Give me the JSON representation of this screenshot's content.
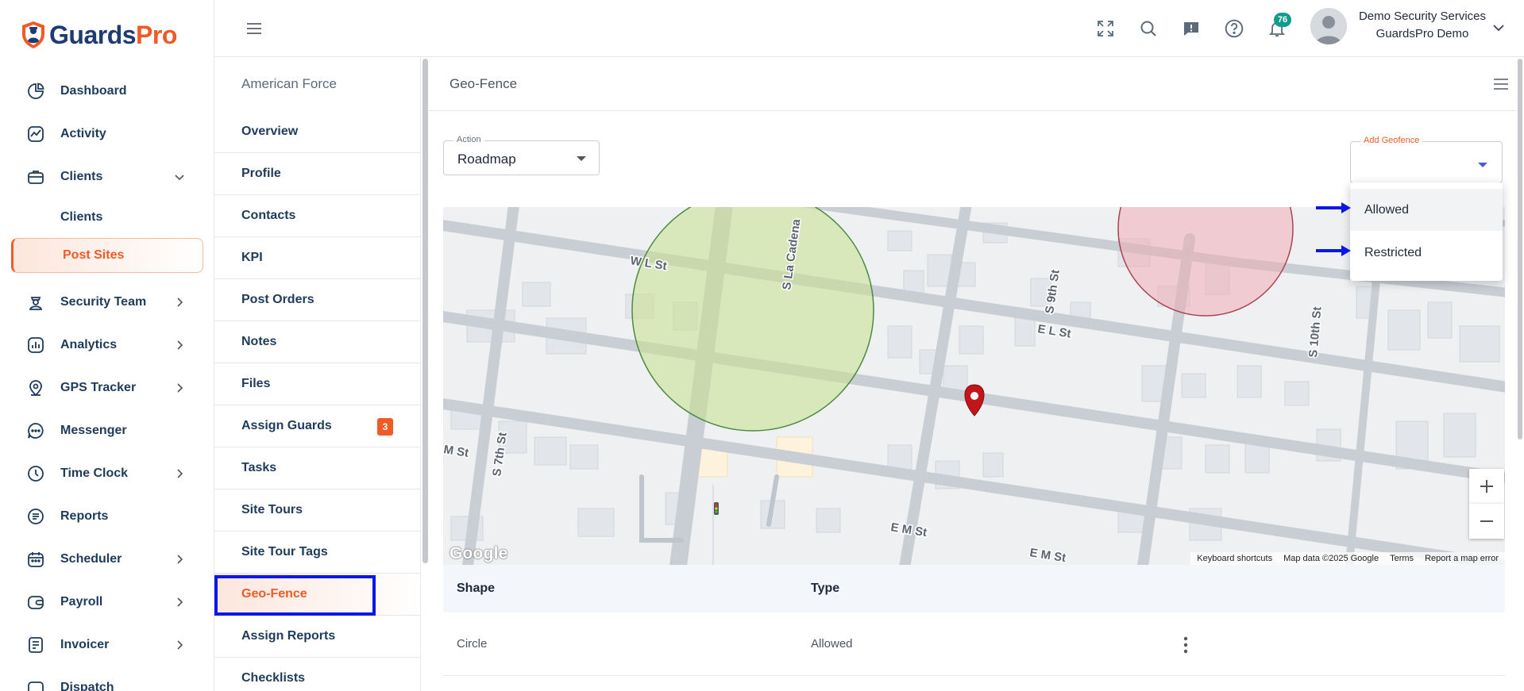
{
  "brand": {
    "name_part1": "Guards",
    "name_part2": "Pro",
    "color_primary": "#1f3b73",
    "color_accent": "#f05a24"
  },
  "sidebar": {
    "items": [
      {
        "label": "Dashboard",
        "icon": "dashboard-icon"
      },
      {
        "label": "Activity",
        "icon": "activity-icon"
      },
      {
        "label": "Clients",
        "icon": "briefcase-icon",
        "expanded": true
      },
      {
        "label": "Security Team",
        "icon": "guard-icon"
      },
      {
        "label": "Analytics",
        "icon": "analytics-icon"
      },
      {
        "label": "GPS Tracker",
        "icon": "location-icon"
      },
      {
        "label": "Messenger",
        "icon": "chat-icon"
      },
      {
        "label": "Time Clock",
        "icon": "clock-icon"
      },
      {
        "label": "Reports",
        "icon": "reports-icon"
      },
      {
        "label": "Scheduler",
        "icon": "calendar-icon"
      },
      {
        "label": "Payroll",
        "icon": "wallet-icon"
      },
      {
        "label": "Invoicer",
        "icon": "invoice-icon"
      },
      {
        "label": "Dispatch",
        "icon": "dispatch-icon"
      }
    ],
    "clients_sub": [
      {
        "label": "Clients"
      },
      {
        "label": "Post Sites",
        "active": true
      }
    ]
  },
  "topbar": {
    "notification_count": "76",
    "user_name": "Demo Security Services",
    "user_org": "GuardsPro Demo"
  },
  "site_menu": {
    "title": "American Force",
    "items": [
      {
        "label": "Overview"
      },
      {
        "label": "Profile"
      },
      {
        "label": "Contacts"
      },
      {
        "label": "KPI"
      },
      {
        "label": "Post Orders"
      },
      {
        "label": "Notes"
      },
      {
        "label": "Files"
      },
      {
        "label": "Assign Guards",
        "badge": "3"
      },
      {
        "label": "Tasks"
      },
      {
        "label": "Site Tours"
      },
      {
        "label": "Site Tour Tags"
      },
      {
        "label": "Geo-Fence",
        "active": true
      },
      {
        "label": "Assign Reports"
      },
      {
        "label": "Checklists"
      }
    ]
  },
  "geofence": {
    "title": "Geo-Fence",
    "action": {
      "label": "Action",
      "value": "Roadmap"
    },
    "add": {
      "label": "Add Geofence",
      "value": ""
    },
    "options": [
      "Allowed",
      "Restricted"
    ]
  },
  "map": {
    "labels": {
      "wl": "W L St",
      "ml": "M St",
      "el": "E L St",
      "em1": "E M St",
      "em2": "E M St",
      "s7": "S 7th St",
      "s9": "S 9th St",
      "s10": "S 10th St",
      "cadena": "S La Cadena"
    },
    "google": "Google",
    "footer": [
      "Keyboard shortcuts",
      "Map data ©2025 Google",
      "Terms",
      "Report a map error"
    ],
    "allowed_color": "#c8e28c",
    "restricted_color": "#f2a7b1"
  },
  "table": {
    "headers": [
      "Shape",
      "Type"
    ],
    "rows": [
      {
        "shape": "Circle",
        "type": "Allowed"
      }
    ]
  }
}
